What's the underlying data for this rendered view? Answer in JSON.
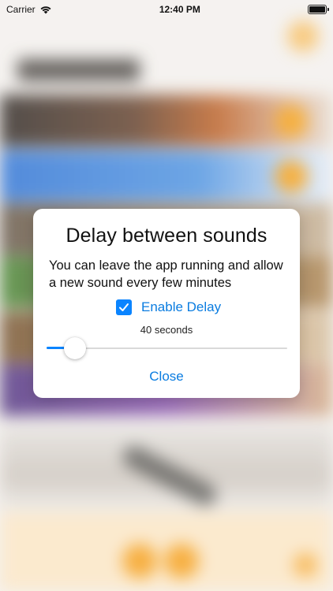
{
  "status_bar": {
    "carrier": "Carrier",
    "time": "12:40 PM",
    "icons": [
      "wifi-icon",
      "battery-icon"
    ]
  },
  "dialog": {
    "title": "Delay between sounds",
    "message": "You can leave the app running and allow a new sound every few minutes",
    "delay_toggle": {
      "label": "Enable Delay",
      "checked": true
    },
    "delay_value": "40 seconds",
    "slider": {
      "value_fraction": 0.11
    },
    "close_label": "Close"
  },
  "colors": {
    "accent": "#0a84ff",
    "link": "#0a7ce0",
    "background_orange": "#f5a627"
  }
}
